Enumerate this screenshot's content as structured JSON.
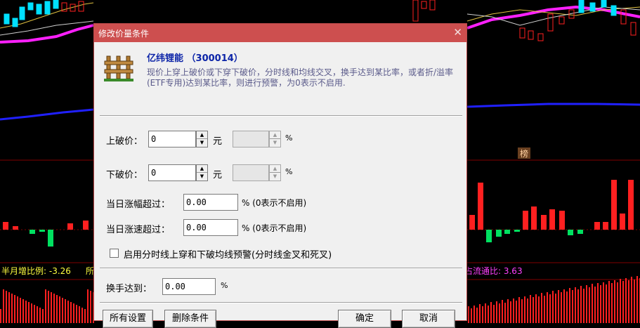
{
  "background": {
    "stat_left": "半月增比例: -3.26",
    "stat_left_cut": "所",
    "stat_right": "占流通比: 3.63",
    "rank_badge": "榜",
    "colors": {
      "up": "#ff2020",
      "down": "#00e060",
      "magenta": "#ff20ff",
      "blue": "#2020ff",
      "stat": "#ffff40",
      "stat_right": "#ff40ff"
    }
  },
  "dialog": {
    "title": "修改价量条件",
    "close_glyph": "✕",
    "icon": "fence-icon",
    "stock_name": "亿纬锂能 （300014）",
    "description": "现价上穿上破价或下穿下破价，分时线和均线交叉，换手达到某比率，或者折/溢率(ETF专用)达到某比率，则进行预警，为0表示不启用.",
    "upper_break": {
      "label": "上破价：",
      "value": "0",
      "unit": "元",
      "pct_value": "",
      "pct_sign": "%"
    },
    "lower_break": {
      "label": "下破价：",
      "value": "0",
      "unit": "元",
      "pct_value": "",
      "pct_sign": "%"
    },
    "day_rise": {
      "label": "当日涨幅超过：",
      "value": "0.00",
      "hint": "% (0表示不启用)"
    },
    "day_speed": {
      "label": "当日涨速超过：",
      "value": "0.00",
      "hint": "% (0表示不启用)"
    },
    "ma_cross": {
      "label": "启用分时线上穿和下破均线预警(分时线金叉和死叉)",
      "checked": false
    },
    "turnover": {
      "label": "换手达到：",
      "value": "0.00",
      "unit": "%"
    },
    "buttons": {
      "all_settings": "所有设置",
      "delete_condition": "删除条件",
      "ok": "确定",
      "cancel": "取消"
    },
    "spin_up": "▲",
    "spin_down": "▼"
  }
}
